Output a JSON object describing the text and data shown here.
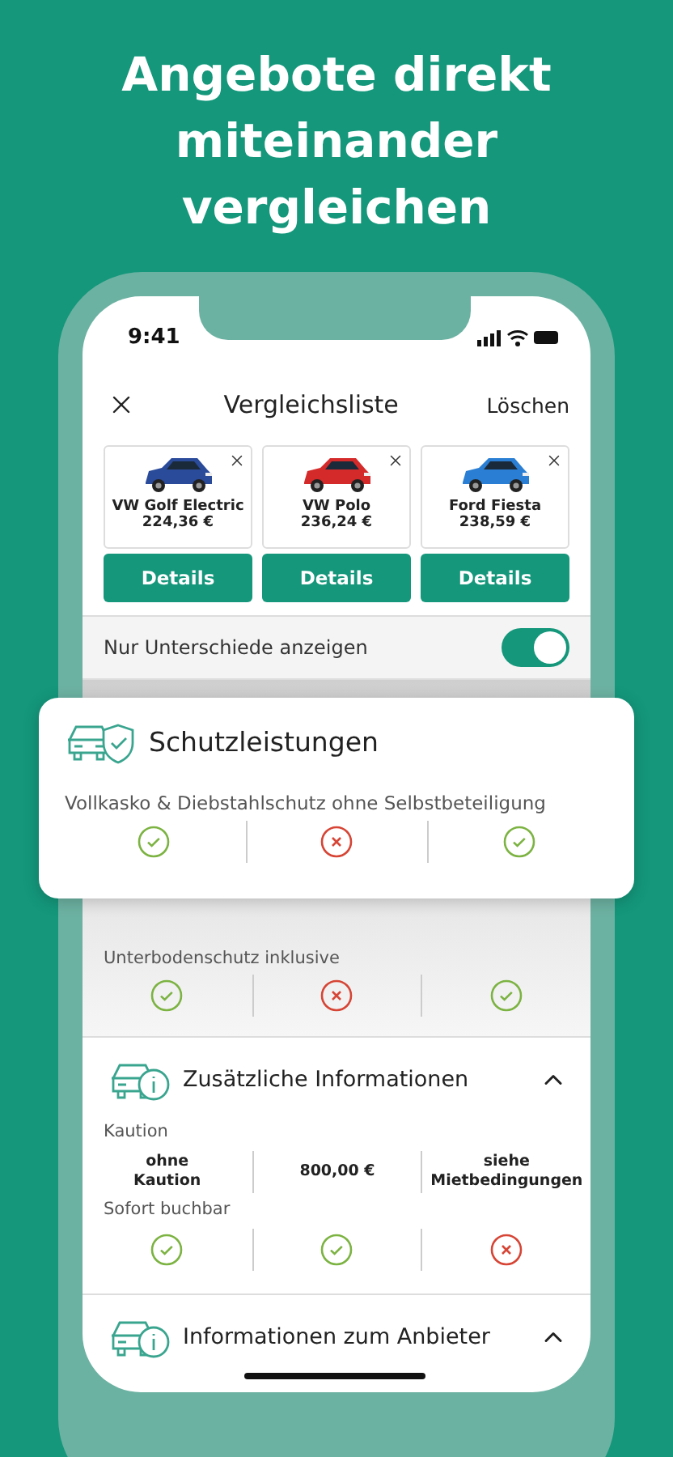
{
  "headline": "Angebote direkt miteinander vergleichen",
  "status_bar": {
    "time": "9:41"
  },
  "header": {
    "title": "Vergleichsliste",
    "action": "Löschen"
  },
  "cars": [
    {
      "name": "VW Golf Electric",
      "price": "224,36 €",
      "button": "Details"
    },
    {
      "name": "VW Polo",
      "price": "236,24 €",
      "button": "Details"
    },
    {
      "name": "Ford Fiesta",
      "price": "238,59 €",
      "button": "Details"
    }
  ],
  "filter": {
    "label": "Nur Unterschiede anzeigen",
    "on": true
  },
  "callout": {
    "title": "Schutzleistungen",
    "rows": [
      {
        "label": "Vollkasko & Diebstahlschutz ohne Selbstbeteiligung",
        "values": [
          {
            "kind": "yes"
          },
          {
            "kind": "no"
          },
          {
            "kind": "yes"
          }
        ]
      }
    ]
  },
  "dimmed_rows": [
    {
      "label": "Unterbodenschutz inklusive",
      "values": [
        {
          "kind": "yes"
        },
        {
          "kind": "no"
        },
        {
          "kind": "yes"
        }
      ]
    }
  ],
  "sections": [
    {
      "title": "Zusätzliche Informationen",
      "expanded": true,
      "rows": [
        {
          "label": "Kaution",
          "values": [
            {
              "kind": "text",
              "text": "ohne Kaution"
            },
            {
              "kind": "text",
              "text": "800,00 €"
            },
            {
              "kind": "text",
              "text": "siehe Mietbedingungen"
            }
          ]
        },
        {
          "label": "Sofort buchbar",
          "values": [
            {
              "kind": "yes"
            },
            {
              "kind": "yes"
            },
            {
              "kind": "no"
            }
          ]
        }
      ]
    },
    {
      "title": "Informationen zum Anbieter",
      "expanded": true
    }
  ]
}
